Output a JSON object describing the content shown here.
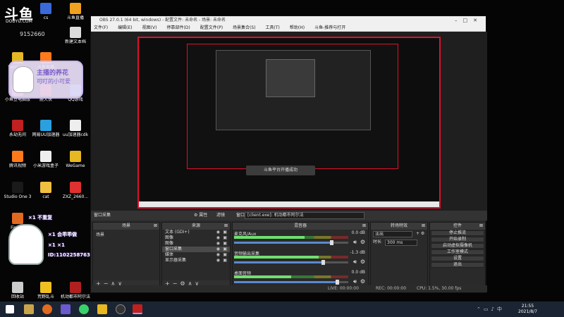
{
  "overlay": {
    "logo": "斗鱼",
    "logo_sub": "DOUYU.COM",
    "room_id": "9152660",
    "sign_line1": "主播的养花",
    "sign_line2": "可叮的小可爱",
    "gift_rows": [
      "×1 不重复",
      "×1 会乖乖做",
      "×1 ×1",
      "ID:1102258763"
    ]
  },
  "desktop_icons": [
    {
      "label": "cs",
      "color": "#3a6ad8"
    },
    {
      "label": "斗鱼直播",
      "color": "#f0a020"
    },
    {
      "label": "新建文本档",
      "color": "#ddd"
    },
    {
      "label": "WeGame",
      "color": "#e6b822"
    },
    {
      "label": "斗鱼直播",
      "color": "#ff7a1a"
    },
    {
      "label": "小鱼豆电脑版",
      "color": "#f060a0"
    },
    {
      "label": "鹿大侠",
      "color": "#d03030"
    },
    {
      "label": "QQ游戏",
      "color": "#2a7ad8"
    },
    {
      "label": "永劫无间",
      "color": "#c02020"
    },
    {
      "label": "网易UU加速器",
      "color": "#2aa0e0"
    },
    {
      "label": "uu加速器cdk",
      "color": "#eee"
    },
    {
      "label": "腾讯视频",
      "color": "#ff7a1a"
    },
    {
      "label": "小米游戏盒子",
      "color": "#eee"
    },
    {
      "label": "WeGame",
      "color": "#e6b822"
    },
    {
      "label": "Studio One 3",
      "color": "#1a1a1a"
    },
    {
      "label": "cat",
      "color": "#f0c040"
    },
    {
      "label": "ZXZ_2660...",
      "color": "#e03030"
    },
    {
      "label": "Firefox",
      "color": "#e06a20"
    },
    {
      "label": "回收站",
      "color": "#ccc"
    },
    {
      "label": "荒野乱斗",
      "color": "#f0c020"
    },
    {
      "label": "机动都市阿尔法",
      "color": "#b02020"
    }
  ],
  "obs": {
    "title": "OBS 27.0.1 (64 bit, windows) - 配置文件: 未命名 - 场景: 未命名",
    "menu": [
      "文件(F)",
      "编辑(E)",
      "视图(V)",
      "停靠部件(D)",
      "配置文件(P)",
      "场景集合(S)",
      "工具(T)",
      "帮助(H)",
      "斗鱼-推荐与打开"
    ],
    "toast": "斗鱼平台开播成功",
    "source_toolbar": {
      "no_source": "窗口采集",
      "properties": "⚙ 属性",
      "filters": "滤镜",
      "window_label": "窗口",
      "window_value": "[client.exe]: 机动都市阿尔法"
    },
    "docks": {
      "scenes": {
        "title": "场景",
        "items": [
          "场景"
        ]
      },
      "sources": {
        "title": "来源",
        "items": [
          {
            "label": "文本 (GDI+)",
            "selected": false
          },
          {
            "label": "图像",
            "selected": false
          },
          {
            "label": "图像",
            "selected": false
          },
          {
            "label": "窗口采集",
            "selected": true
          },
          {
            "label": "媒体",
            "selected": false
          },
          {
            "label": "显示器采集",
            "selected": false
          }
        ]
      },
      "mixer": {
        "title": "混音器",
        "channels": [
          {
            "name": "麦克风/Aux",
            "db": "0.0 dB",
            "level": 0.62,
            "volume": 0.85
          },
          {
            "name": "音频输出采集",
            "db": "-1.3 dB",
            "level": 0.74,
            "volume": 0.78
          },
          {
            "name": "桌面音频",
            "db": "0.0 dB",
            "level": 0.5,
            "volume": 0.9
          }
        ]
      },
      "transitions": {
        "title": "转场特效",
        "type": "淡出",
        "duration_label": "时长",
        "duration": "300 ms"
      },
      "controls": {
        "title": "控件",
        "buttons": [
          "停止推流",
          "开始录制",
          "启动虚拟摄像机",
          "工作室模式",
          "设置",
          "退出"
        ]
      }
    },
    "status": {
      "live": "LIVE: 00:00:00",
      "rec": "REC: 00:00:00",
      "cpu": "CPU: 1.5%, 30.00 fps"
    }
  },
  "taskbar": {
    "time": "21:55",
    "date": "2021/8/7"
  }
}
